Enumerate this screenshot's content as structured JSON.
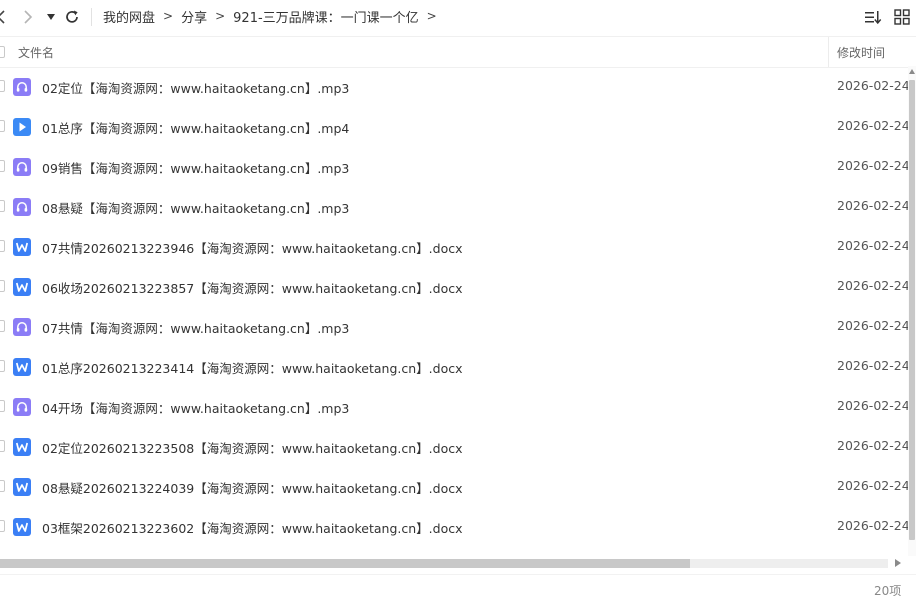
{
  "nav": {
    "breadcrumb": [
      "我的网盘",
      "分享",
      "921-三万品牌课：一门课一个亿"
    ],
    "separator": ">"
  },
  "columns": {
    "name": "文件名",
    "modified": "修改时间"
  },
  "icons": {
    "audio_color": "#8b7cf6",
    "video_color": "#3b8af5",
    "doc_color": "#3b7ff5"
  },
  "files": [
    {
      "name": "02定位【海淘资源网：www.haitaoketang.cn】.mp3",
      "date": "2026-02-24",
      "type": "audio"
    },
    {
      "name": "01总序【海淘资源网：www.haitaoketang.cn】.mp4",
      "date": "2026-02-24",
      "type": "video"
    },
    {
      "name": "09销售【海淘资源网：www.haitaoketang.cn】.mp3",
      "date": "2026-02-24",
      "type": "audio"
    },
    {
      "name": "08悬疑【海淘资源网：www.haitaoketang.cn】.mp3",
      "date": "2026-02-24",
      "type": "audio"
    },
    {
      "name": "07共情20260213223946【海淘资源网：www.haitaoketang.cn】.docx",
      "date": "2026-02-24",
      "type": "doc"
    },
    {
      "name": "06收场20260213223857【海淘资源网：www.haitaoketang.cn】.docx",
      "date": "2026-02-24",
      "type": "doc"
    },
    {
      "name": "07共情【海淘资源网：www.haitaoketang.cn】.mp3",
      "date": "2026-02-24",
      "type": "audio"
    },
    {
      "name": "01总序20260213223414【海淘资源网：www.haitaoketang.cn】.docx",
      "date": "2026-02-24",
      "type": "doc"
    },
    {
      "name": "04开场【海淘资源网：www.haitaoketang.cn】.mp3",
      "date": "2026-02-24",
      "type": "audio"
    },
    {
      "name": "02定位20260213223508【海淘资源网：www.haitaoketang.cn】.docx",
      "date": "2026-02-24",
      "type": "doc"
    },
    {
      "name": "08悬疑20260213224039【海淘资源网：www.haitaoketang.cn】.docx",
      "date": "2026-02-24",
      "type": "doc"
    },
    {
      "name": "03框架20260213223602【海淘资源网：www.haitaoketang.cn】.docx",
      "date": "2026-02-24",
      "type": "doc"
    }
  ],
  "footer": {
    "count": "20项"
  }
}
